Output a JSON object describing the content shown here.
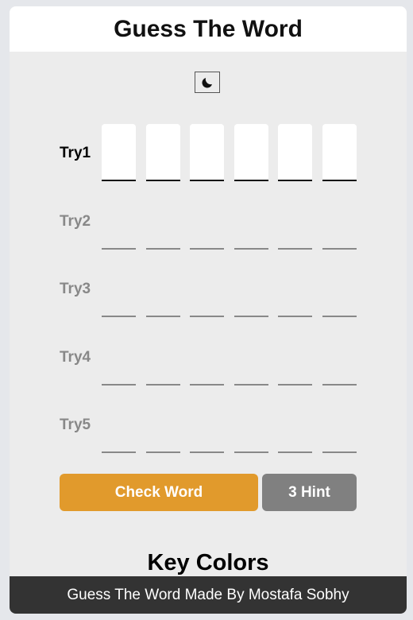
{
  "header": {
    "title": "Guess The Word"
  },
  "theme_toggle": {
    "icon": "moon-icon"
  },
  "tries": [
    {
      "label": "Try1",
      "active": true
    },
    {
      "label": "Try2",
      "active": false
    },
    {
      "label": "Try3",
      "active": false
    },
    {
      "label": "Try4",
      "active": false
    },
    {
      "label": "Try5",
      "active": false
    }
  ],
  "letters_per_try": 6,
  "buttons": {
    "check": "Check Word",
    "hint": "3 Hint"
  },
  "key_colors": {
    "title": "Key Colors"
  },
  "footer": {
    "text": "Guess The Word Made By Mostafa Sobhy"
  },
  "colors": {
    "check_button": "#e19a2c",
    "hint_button": "#808080",
    "footer_bg": "#333333",
    "page_bg": "#ececec"
  }
}
